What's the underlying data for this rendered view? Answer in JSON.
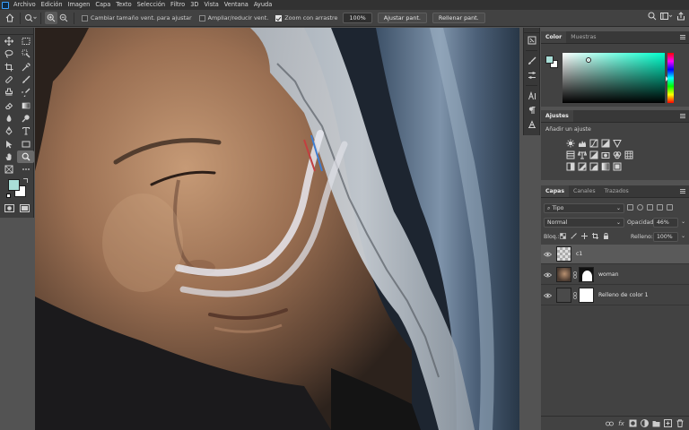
{
  "menubar": {
    "items": [
      "Archivo",
      "Edición",
      "Imagen",
      "Capa",
      "Texto",
      "Selección",
      "Filtro",
      "3D",
      "Vista",
      "Ventana",
      "Ayuda"
    ]
  },
  "options": {
    "resize_windows_label": "Cambiar tamaño vent. para ajustar",
    "resize_windows_checked": false,
    "zoom_all_label": "Ampliar/reducir vent.",
    "zoom_all_checked": false,
    "scrubby_zoom_label": "Zoom con arrastre",
    "scrubby_zoom_checked": true,
    "zoom_percent": "100%",
    "fit_screen_label": "Ajustar pant.",
    "fill_screen_label": "Rellenar pant."
  },
  "toolbar": {
    "foreground_color": "#a9dfd8",
    "background_color": "#ffffff",
    "active_tool": "zoom-tool"
  },
  "color_panel": {
    "tabs": [
      "Color",
      "Muestras"
    ],
    "active_tab": "Color",
    "foreground_color": "#a9dfd8",
    "hue_color": "#00ffcc"
  },
  "adjustments_panel": {
    "title": "Ajustes",
    "subtitle": "Añadir un ajuste"
  },
  "layers_panel": {
    "tabs": [
      "Capas",
      "Canales",
      "Trazados"
    ],
    "active_tab": "Capas",
    "filter_kind": "Tipo",
    "blend_mode": "Normal",
    "opacity_label": "Opacidad:",
    "opacity_value": "46%",
    "lock_label": "Bloq.:",
    "fill_label": "Relleno:",
    "fill_value": "100%",
    "layers": [
      {
        "name": "c1",
        "visible": true,
        "selected": true
      },
      {
        "name": "woman",
        "visible": true,
        "selected": false
      },
      {
        "name": "Relleno de color 1",
        "visible": true,
        "selected": false
      }
    ]
  }
}
